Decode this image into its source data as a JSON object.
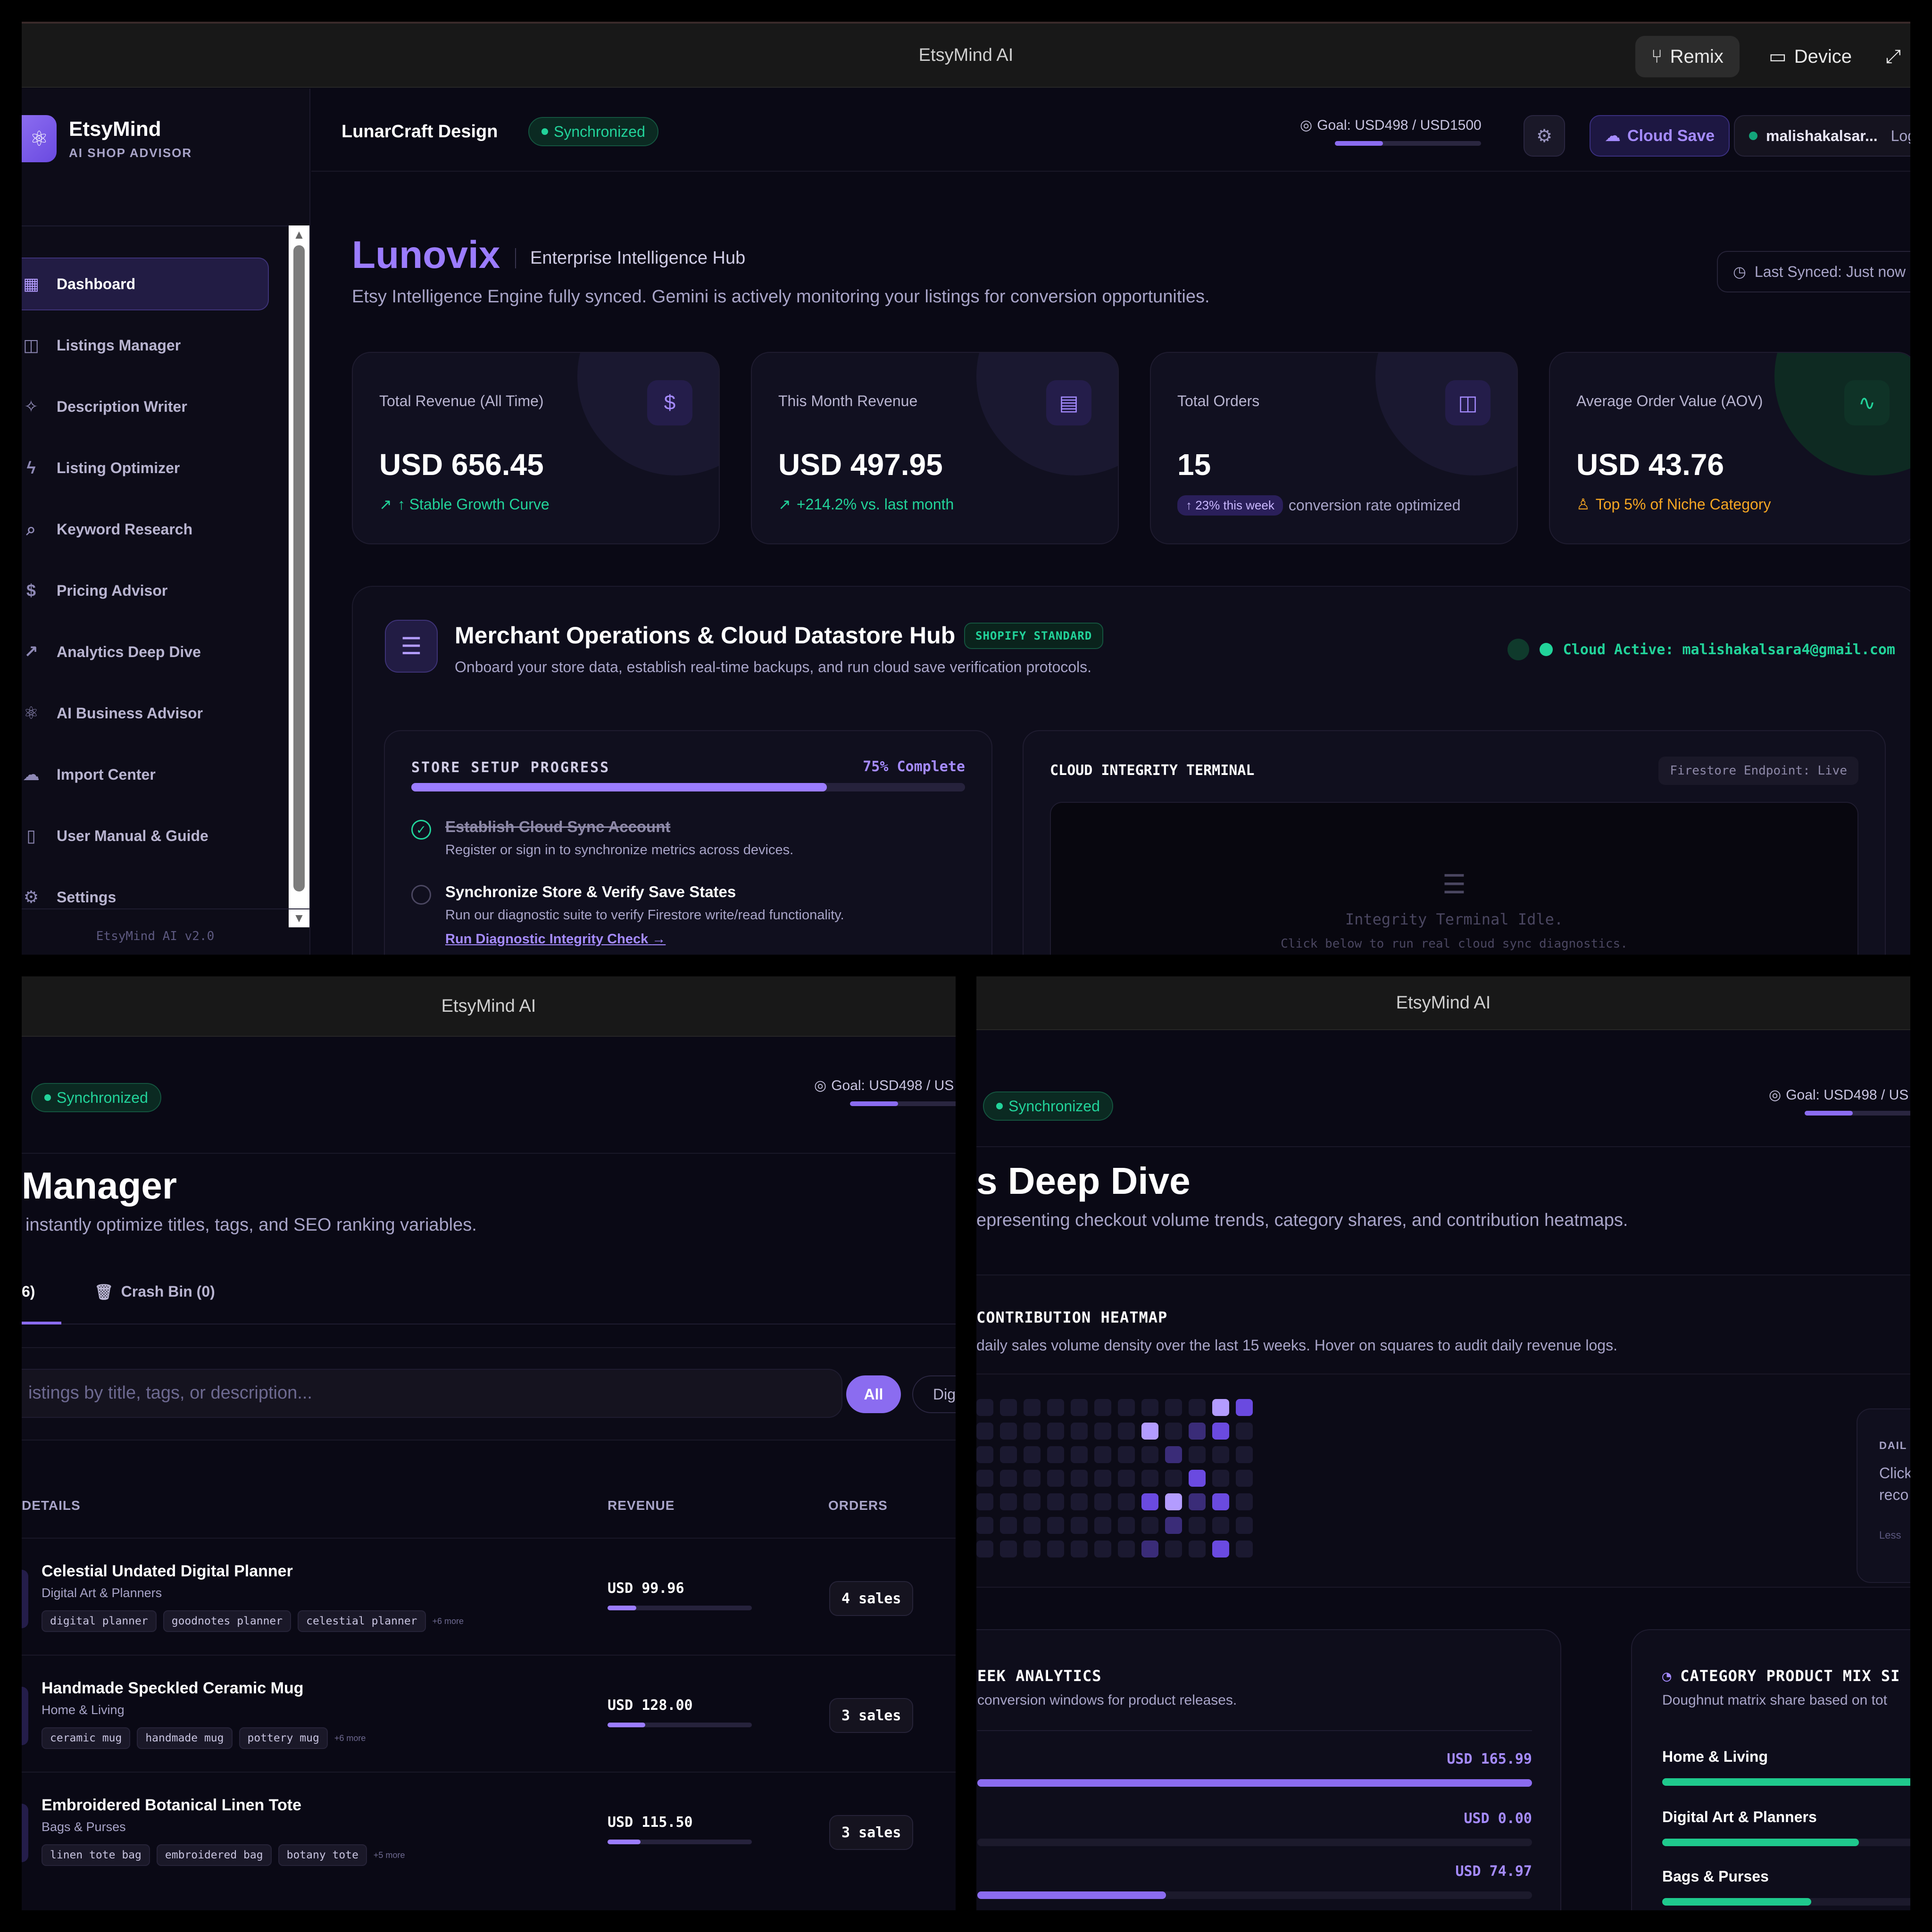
{
  "app": {
    "title": "EtsyMind AI",
    "remix_label": "Remix",
    "device_label": "Device"
  },
  "brand": {
    "name": "EtsyMind",
    "subtitle": "AI SHOP ADVISOR",
    "version": "EtsyMind AI v2.0"
  },
  "sidebar": {
    "items": [
      {
        "label": "Dashboard",
        "icon": "grid-icon",
        "active": true
      },
      {
        "label": "Listings Manager",
        "icon": "bag-icon"
      },
      {
        "label": "Description Writer",
        "icon": "sparkle-icon"
      },
      {
        "label": "Listing Optimizer",
        "icon": "bolt-icon"
      },
      {
        "label": "Keyword Research",
        "icon": "search-icon"
      },
      {
        "label": "Pricing Advisor",
        "icon": "dollar-icon"
      },
      {
        "label": "Analytics Deep Dive",
        "icon": "trend-icon"
      },
      {
        "label": "AI Business Advisor",
        "icon": "brain-icon"
      },
      {
        "label": "Import Center",
        "icon": "cloud-upload-icon"
      },
      {
        "label": "User Manual & Guide",
        "icon": "book-icon"
      },
      {
        "label": "Settings",
        "icon": "gear-icon"
      }
    ]
  },
  "header": {
    "shop_name": "LunarCraft Design",
    "sync_status": "Synchronized",
    "goal_label": "Goal: USD498 / USD1500",
    "goal_label_cut": "Goal: USD498 / US",
    "goal_progress": 0.33,
    "cloud_save_label": "Cloud Save",
    "user_name": "malishakalsar...",
    "logout_label": "Logout"
  },
  "dashboard": {
    "title": "Lunovix",
    "subtitle": "Enterprise Intelligence Hub",
    "description": "Etsy Intelligence Engine fully synced. Gemini is actively monitoring your listings for conversion opportunities.",
    "last_synced": "Last Synced: Just now",
    "stats": [
      {
        "label": "Total Revenue (All Time)",
        "value": "USD 656.45",
        "note": "↑ Stable Growth Curve",
        "icon": "dollar-icon"
      },
      {
        "label": "This Month Revenue",
        "value": "USD 497.95",
        "note": "+214.2% vs. last month",
        "icon": "calendar-icon"
      },
      {
        "label": "Total Orders",
        "value": "15",
        "pill": "↑ 23% this week",
        "note": "conversion rate optimized",
        "icon": "bag-icon"
      },
      {
        "label": "Average Order Value (AOV)",
        "value": "USD 43.76",
        "note": "Top 5% of Niche Category",
        "icon": "pulse-icon"
      }
    ]
  },
  "hub": {
    "title": "Merchant Operations & Cloud Datastore Hub",
    "badge": "SHOPIFY STANDARD",
    "description": "Onboard your store data, establish real-time backups, and run cloud save verification protocols.",
    "cloud_status": "Cloud Active: malishakalsara4@gmail.com",
    "setup": {
      "heading": "STORE SETUP PROGRESS",
      "percent_label": "75% Complete",
      "progress": 0.75,
      "steps": [
        {
          "title": "Establish Cloud Sync Account",
          "desc": "Register or sign in to synchronize metrics across devices.",
          "done": true
        },
        {
          "title": "Synchronize Store & Verify Save States",
          "desc": "Run our diagnostic suite to verify Firestore write/read functionality.",
          "link": "Run Diagnostic Integrity Check",
          "done": false
        }
      ]
    },
    "terminal": {
      "heading": "CLOUD INTEGRITY TERMINAL",
      "endpoint": "Firestore Endpoint: Live",
      "idle": "Integrity Terminal Idle.",
      "hint": "Click below to run real cloud sync diagnostics."
    }
  },
  "listings": {
    "title": "Manager",
    "description": "instantly optimize titles, tags, and SEO ranking variables.",
    "tab_active": "6)",
    "tab_trash": "Crash Bin (0)",
    "search_placeholder": "istings by title, tags, or description...",
    "filter_all": "All",
    "filter_dig": "Dig",
    "columns": {
      "details": "DETAILS",
      "revenue": "REVENUE",
      "orders": "ORDERS"
    },
    "rows": [
      {
        "title": "Celestial Undated Digital Planner",
        "category": "Digital Art & Planners",
        "tags": [
          "digital planner",
          "goodnotes planner",
          "celestial planner"
        ],
        "more": "+6 more",
        "revenue": "USD 99.96",
        "revenue_share": 0.2,
        "sales": "4 sales"
      },
      {
        "title": "Handmade Speckled Ceramic Mug",
        "category": "Home & Living",
        "tags": [
          "ceramic mug",
          "handmade mug",
          "pottery mug"
        ],
        "more": "+6 more",
        "revenue": "USD 128.00",
        "revenue_share": 0.26,
        "sales": "3 sales"
      },
      {
        "title": "Embroidered Botanical Linen Tote",
        "category": "Bags & Purses",
        "tags": [
          "linen tote bag",
          "embroidered bag",
          "botany tote"
        ],
        "more": "+5 more",
        "revenue": "USD 115.50",
        "revenue_share": 0.23,
        "sales": "3 sales"
      }
    ]
  },
  "analytics": {
    "title": "s Deep Dive",
    "description": "epresenting checkout volume trends, category shares, and contribution heatmaps.",
    "heatmap": {
      "heading": "CONTRIBUTION HEATMAP",
      "description": "daily sales volume density over the last 15 weeks. Hover on squares to audit daily revenue logs."
    },
    "daily": {
      "label": "DAIL",
      "text": "Click reco",
      "legend": "Less"
    },
    "weekly": {
      "heading": "EEK ANALYTICS",
      "description": "conversion windows for product releases.",
      "values": [
        {
          "label": "USD 165.99",
          "share": 1.0
        },
        {
          "label": "USD 0.00",
          "share": 0.0
        },
        {
          "label": "USD 74.97",
          "share": 0.34
        }
      ]
    },
    "mix": {
      "heading": "CATEGORY PRODUCT MIX SI",
      "description": "Doughnut matrix share based on tot",
      "items": [
        {
          "label": "Home & Living",
          "share": 1.0
        },
        {
          "label": "Digital Art & Planners",
          "share": 0.66
        },
        {
          "label": "Bags & Purses",
          "share": 0.5
        }
      ]
    }
  },
  "colors": {
    "accent": "#8b6cf0",
    "success": "#22d39a",
    "warning": "#f5a623",
    "background": "#0a0915"
  }
}
